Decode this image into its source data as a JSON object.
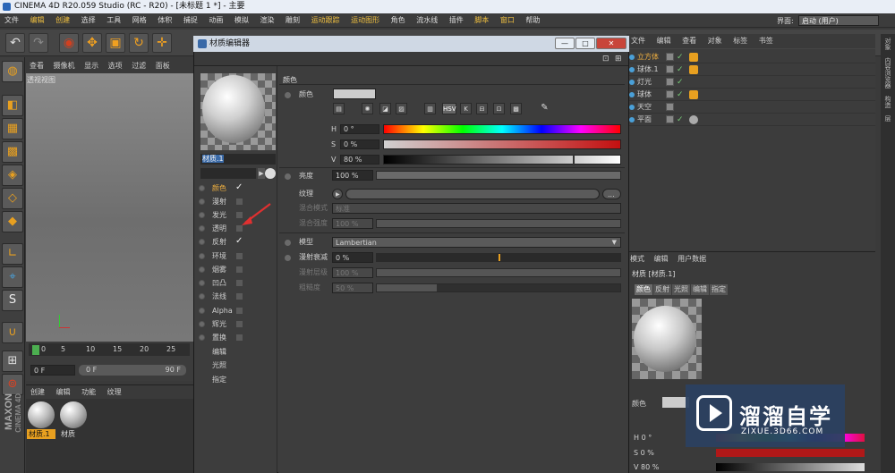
{
  "window": {
    "title": "CINEMA 4D R20.059 Studio (RC - R20) - [未标题 1 *] - 主要"
  },
  "menubar": [
    "文件",
    "编辑",
    "创建",
    "选择",
    "工具",
    "网格",
    "体积",
    "捕捉",
    "动画",
    "模拟",
    "渲染",
    "雕刻",
    "运动跟踪",
    "运动图形",
    "角色",
    "流水线",
    "插件",
    "脚本",
    "窗口",
    "帮助"
  ],
  "layout": {
    "label": "界面:",
    "value": "启动 (用户)"
  },
  "viewport": {
    "menu": [
      "查看",
      "摄像机",
      "显示",
      "选项",
      "过滤",
      "面板"
    ],
    "label": "透视视图"
  },
  "timeline": {
    "ticks": [
      "0",
      "5",
      "10",
      "15",
      "20",
      "25"
    ],
    "start": "0 F",
    "range_start": "0 F",
    "range_end": "90 F"
  },
  "material_manager": {
    "menu": [
      "创建",
      "编辑",
      "功能",
      "纹理"
    ],
    "materials": [
      "材质.1",
      "材质"
    ]
  },
  "object_manager": {
    "menu": [
      "文件",
      "编辑",
      "查看",
      "对象",
      "标签",
      "书签"
    ],
    "objects": [
      "立方体",
      "球体.1",
      "灯光",
      "球体",
      "天空",
      "平面"
    ]
  },
  "attribute_manager": {
    "menu": [
      "模式",
      "编辑",
      "用户数据"
    ],
    "title": "材质 [材质.1]",
    "tabs": [
      "颜色",
      "反射",
      "光照",
      "编辑",
      "指定"
    ],
    "color_label": "颜色",
    "h_label": "H",
    "h_value": "0 °",
    "s_label": "S",
    "s_value": "0 %",
    "v_label": "V",
    "v_value": "80 %"
  },
  "side_tabs": [
    "对象",
    "内容浏览器",
    "构造",
    "层"
  ],
  "watermark": {
    "brand": "溜溜自学",
    "url": "ZIXUE.3D66.COM"
  },
  "material_editor": {
    "title": "材质编辑器",
    "material_name": "材质.1",
    "channels": [
      {
        "name": "颜色",
        "checked": true,
        "active": true
      },
      {
        "name": "漫射",
        "checked": false
      },
      {
        "name": "发光",
        "checked": false
      },
      {
        "name": "透明",
        "checked": false
      },
      {
        "name": "反射",
        "checked": true
      },
      {
        "name": "环境",
        "checked": false
      },
      {
        "name": "烟雾",
        "checked": false
      },
      {
        "name": "凹凸",
        "checked": false
      },
      {
        "name": "法线",
        "checked": false
      },
      {
        "name": "Alpha",
        "checked": false
      },
      {
        "name": "辉光",
        "checked": false
      },
      {
        "name": "置换",
        "checked": false
      }
    ],
    "extra": [
      "编辑",
      "光照",
      "指定"
    ],
    "section": "颜色",
    "color_label": "颜色",
    "icon_buttons": [
      "HSV"
    ],
    "h": {
      "label": "H",
      "value": "0 °"
    },
    "s": {
      "label": "S",
      "value": "0 %"
    },
    "v": {
      "label": "V",
      "value": "80 %"
    },
    "brightness": {
      "label": "亮度",
      "value": "100 %"
    },
    "texture": {
      "label": "纹理"
    },
    "mix_mode": {
      "label": "混合模式",
      "value": "标准"
    },
    "mix_strength": {
      "label": "混合强度",
      "value": "100 %"
    },
    "model": {
      "label": "模型",
      "value": "Lambertian"
    },
    "diffuse_falloff": {
      "label": "漫射衰减",
      "value": "0 %"
    },
    "diffuse_level": {
      "label": "漫射层级",
      "value": "100 %"
    },
    "roughness": {
      "label": "粗糙度",
      "value": "50 %"
    },
    "win_buttons": [
      "—",
      "□",
      "✕"
    ]
  }
}
